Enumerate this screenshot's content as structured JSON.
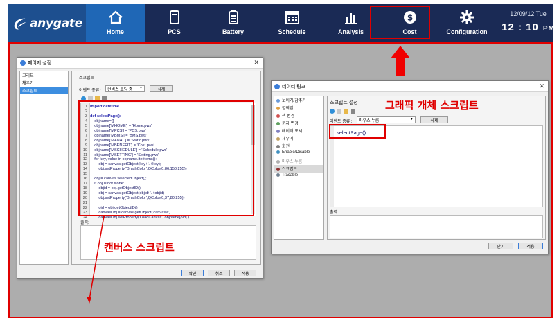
{
  "nav": {
    "logo_text": "anygate",
    "items": [
      {
        "label": "Home",
        "icon": "home-icon",
        "active": true
      },
      {
        "label": "PCS",
        "icon": "pcs-icon"
      },
      {
        "label": "Battery",
        "icon": "battery-icon"
      },
      {
        "label": "Schedule",
        "icon": "schedule-icon"
      },
      {
        "label": "Analysis",
        "icon": "analysis-icon"
      },
      {
        "label": "Cost",
        "icon": "cost-icon",
        "highlighted": true
      },
      {
        "label": "Configuration",
        "icon": "gear-icon"
      }
    ],
    "date": "12/09/12 Tue",
    "time": "12 : 10",
    "ampm": "PM"
  },
  "left_dialog": {
    "title": "페이지 설정",
    "list": [
      "그리드",
      "채우기",
      "스크립트"
    ],
    "selected_index": 2,
    "section_title": "스크립트",
    "event_label": "이벤트 종류 :",
    "event_value": "컨버스 로딩 중",
    "delete_label": "삭제",
    "output_label": "출력:",
    "buttons": {
      "ok": "확인",
      "cancel": "취소",
      "apply": "적용"
    },
    "code": [
      {
        "n": "1",
        "t": "import datetime"
      },
      {
        "n": "2",
        "t": ""
      },
      {
        "n": "3",
        "t": "def selectPage():"
      },
      {
        "n": "4",
        "t": "    objname={}"
      },
      {
        "n": "5",
        "t": "    objname['MHOME'] = 'Home.pws'"
      },
      {
        "n": "6",
        "t": "    objname['MPCS'] = 'PCS.pws'"
      },
      {
        "n": "7",
        "t": "    objname['MBMS'] = 'BMS.pws'"
      },
      {
        "n": "8",
        "t": "    objname['MANAL'] = 'Static.pws'"
      },
      {
        "n": "9",
        "t": "    objname['MBENEFIT'] = 'Cost.pws'"
      },
      {
        "n": "10",
        "t": "    objname['MSCHEDULE'] = 'Schedule.pws'"
      },
      {
        "n": "11",
        "t": "    objname['MSETTING'] = 'Setting.pws'"
      },
      {
        "n": "12",
        "t": "    for key, value in objname.iteritems():"
      },
      {
        "n": "13",
        "t": "        obj = canvas.getObject(key+'.'+key);"
      },
      {
        "n": "14",
        "t": "        obj.setProperty('BrushColor',QColor(0,86,150,255))"
      },
      {
        "n": "15",
        "t": ""
      },
      {
        "n": "16",
        "t": "    obj = canvas.selectedObject();"
      },
      {
        "n": "17",
        "t": "    if obj is not None:"
      },
      {
        "n": "18",
        "t": "        objid = obj.getObjectID()"
      },
      {
        "n": "19",
        "t": "        obj = canvas.getObject(objid+'.'+objid)"
      },
      {
        "n": "20",
        "t": "        obj.setProperty('BrushColor',QColor(0,37,80,255))"
      },
      {
        "n": "21",
        "t": ""
      },
      {
        "n": "22",
        "t": "        oid = obj.getObjectID()"
      },
      {
        "n": "23",
        "t": "        canvasObj = canvas.getObject('canvasw')"
      },
      {
        "n": "24",
        "t": "        canvasObj.setProperty('LoadCanvas', objname[oid] )"
      }
    ]
  },
  "right_dialog": {
    "title": "데이터 링크",
    "list": [
      "보이기/감추기",
      "깜빡임",
      "색 변경",
      "문자 변경",
      "데이터 표시",
      "채우기",
      "회전",
      "Enable/Disable",
      "마우스 누름",
      "스크립트",
      "Tracable"
    ],
    "selected_index": 9,
    "section_title": "스크립트 설정",
    "event_label": "이벤트 종류 :",
    "event_value": "마우스 누름",
    "delete_label": "삭제",
    "script": "selectPage()",
    "output_label": "출력",
    "buttons": {
      "close": "닫기",
      "apply": "적용"
    }
  },
  "annotations": {
    "object_script": "그래픽 개체 스크립트",
    "canvas_script": "캔버스 스크립트"
  },
  "colors": {
    "highlight": "#e00000",
    "nav_bg": "#1a2a55",
    "nav_active": "#1f67b6"
  }
}
